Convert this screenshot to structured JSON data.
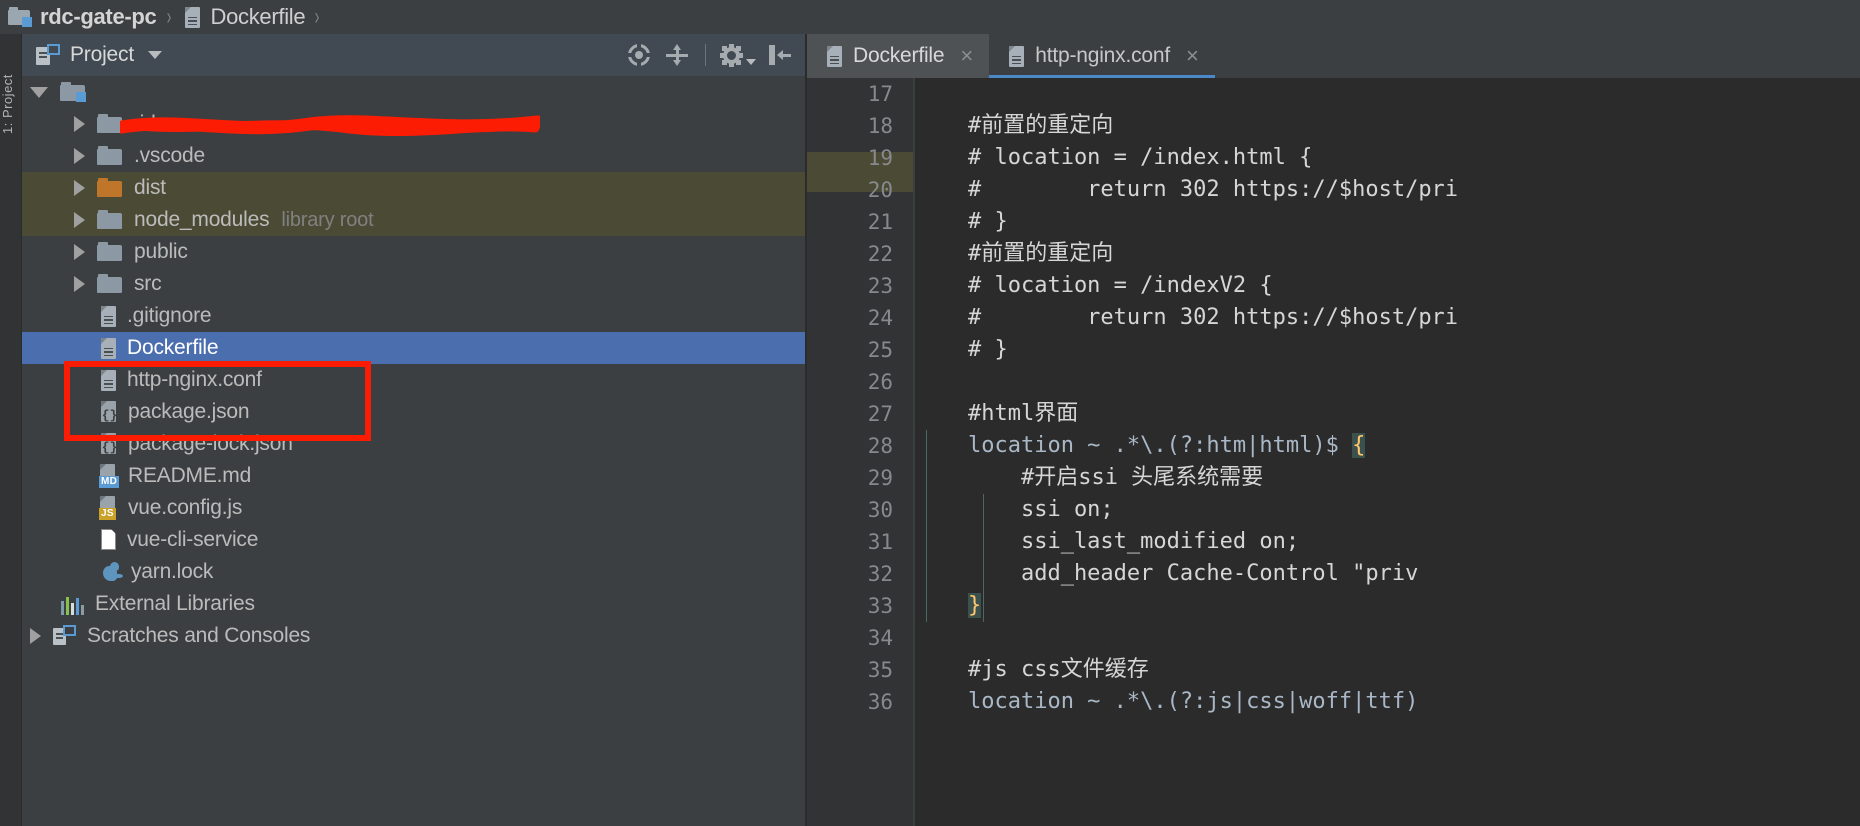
{
  "breadcrumb": {
    "items": [
      {
        "label": "rdc-gate-pc",
        "icon": "module-icon",
        "bold": true
      },
      {
        "label": "Dockerfile",
        "icon": "file-icon",
        "bold": false
      }
    ],
    "separator": "›"
  },
  "left_stripe": {
    "project_tool_label": "1: Project"
  },
  "project_panel": {
    "title": "Project",
    "dropdown_caret": "▾",
    "toolbar": [
      {
        "name": "locate-in-tree-icon",
        "tooltip": "Select Opened File"
      },
      {
        "name": "collapse-all-icon",
        "tooltip": "Collapse All"
      },
      {
        "name": "settings-gear-icon",
        "tooltip": "Options"
      },
      {
        "name": "hide-panel-icon",
        "tooltip": "Hide"
      }
    ],
    "tree": [
      {
        "label": "",
        "secondary": "",
        "indent": 0,
        "icon": "module-folder-icon",
        "twisty": "open",
        "state": "scribbled",
        "obscured": true
      },
      {
        "label": ".idea",
        "secondary": "",
        "indent": 1,
        "icon": "folder-icon",
        "twisty": "closed",
        "state": "normal"
      },
      {
        "label": ".vscode",
        "secondary": "",
        "indent": 1,
        "icon": "folder-icon",
        "twisty": "closed",
        "state": "normal"
      },
      {
        "label": "dist",
        "secondary": "",
        "indent": 1,
        "icon": "folder-orange-icon",
        "twisty": "closed",
        "state": "excluded"
      },
      {
        "label": "node_modules",
        "secondary": "library root",
        "indent": 1,
        "icon": "folder-icon",
        "twisty": "closed",
        "state": "excluded"
      },
      {
        "label": "public",
        "secondary": "",
        "indent": 1,
        "icon": "folder-icon",
        "twisty": "closed",
        "state": "normal"
      },
      {
        "label": "src",
        "secondary": "",
        "indent": 1,
        "icon": "folder-icon",
        "twisty": "closed",
        "state": "normal"
      },
      {
        "label": ".gitignore",
        "secondary": "",
        "indent": 1,
        "icon": "file-icon",
        "twisty": "none",
        "state": "normal"
      },
      {
        "label": "Dockerfile",
        "secondary": "",
        "indent": 1,
        "icon": "file-icon",
        "twisty": "none",
        "state": "selected"
      },
      {
        "label": "http-nginx.conf",
        "secondary": "",
        "indent": 1,
        "icon": "file-icon",
        "twisty": "none",
        "state": "normal"
      },
      {
        "label": "package.json",
        "secondary": "",
        "indent": 1,
        "icon": "json-icon",
        "twisty": "none",
        "state": "normal"
      },
      {
        "label": "package-lock.json",
        "secondary": "",
        "indent": 1,
        "icon": "json-icon",
        "twisty": "none",
        "state": "normal"
      },
      {
        "label": "README.md",
        "secondary": "",
        "indent": 1,
        "icon": "markdown-icon",
        "twisty": "none",
        "state": "normal",
        "badge": "MD"
      },
      {
        "label": "vue.config.js",
        "secondary": "",
        "indent": 1,
        "icon": "javascript-icon",
        "twisty": "none",
        "state": "normal",
        "badge": "JS"
      },
      {
        "label": "vue-cli-service",
        "secondary": "",
        "indent": 1,
        "icon": "blank-file-icon",
        "twisty": "none",
        "state": "normal"
      },
      {
        "label": "yarn.lock",
        "secondary": "",
        "indent": 1,
        "icon": "yarn-icon",
        "twisty": "none",
        "state": "normal"
      },
      {
        "label": "External Libraries",
        "secondary": "",
        "indent": 0,
        "icon": "external-libraries-icon",
        "twisty": "none",
        "state": "normal"
      },
      {
        "label": "Scratches and Consoles",
        "secondary": "",
        "indent": 0,
        "icon": "scratches-icon",
        "twisty": "closed",
        "state": "normal"
      }
    ]
  },
  "annotations": {
    "red_scribble_over_root": true,
    "red_rectangle_highlight_rows": [
      "Dockerfile",
      "http-nginx.conf"
    ],
    "annotation_color": "#fc1c03"
  },
  "editor": {
    "tabs": [
      {
        "label": "Dockerfile",
        "icon": "file-icon",
        "active": true,
        "close": "×"
      },
      {
        "label": "http-nginx.conf",
        "icon": "file-icon",
        "active": false,
        "close": "×"
      }
    ],
    "first_visible_line": 17,
    "lines": [
      {
        "n": 17,
        "text": ""
      },
      {
        "n": 18,
        "text": "    #前置的重定向"
      },
      {
        "n": 19,
        "text": "    # location = /index.html {"
      },
      {
        "n": 20,
        "text": "    #        return 302 https://$host/pri"
      },
      {
        "n": 21,
        "text": "    # }"
      },
      {
        "n": 22,
        "text": "    #前置的重定向"
      },
      {
        "n": 23,
        "text": "    # location = /indexV2 {"
      },
      {
        "n": 24,
        "text": "    #        return 302 https://$host/pri"
      },
      {
        "n": 25,
        "text": "    # }"
      },
      {
        "n": 26,
        "text": ""
      },
      {
        "n": 27,
        "text": "    #html界面"
      },
      {
        "n": 28,
        "text": "    location ~ .*\\.(?:htm|html)$ {"
      },
      {
        "n": 29,
        "text": "        #开启ssi 头尾系统需要"
      },
      {
        "n": 30,
        "text": "        ssi on;"
      },
      {
        "n": 31,
        "text": "        ssi_last_modified on;"
      },
      {
        "n": 32,
        "text": "        add_header Cache-Control \"priv"
      },
      {
        "n": 33,
        "text": "    }"
      },
      {
        "n": 34,
        "text": ""
      },
      {
        "n": 35,
        "text": "    #js css文件缓存"
      },
      {
        "n": 36,
        "text": "    location ~ .*\\.(?:js|css|woff|ttf)"
      }
    ]
  },
  "colors": {
    "panel_bg": "#3c3f41",
    "panel_header_bg": "#414a52",
    "editor_bg": "#2b2b2b",
    "gutter_bg": "#313335",
    "selection_blue": "#4b6eaf",
    "excluded_olive": "#4b4b35",
    "tab_active_bg": "#4e5254",
    "tab_underline": "#4a88c7",
    "code_fg": "#a9b7c6",
    "brace_highlight_bg": "#3b514d",
    "brace_highlight_fg": "#ffc66d",
    "annotation_red": "#fc1c03"
  }
}
